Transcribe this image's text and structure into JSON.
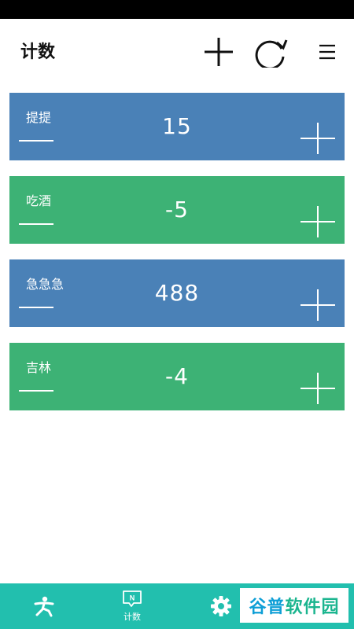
{
  "header": {
    "title": "计数",
    "add_icon": "plus-icon",
    "refresh_icon": "refresh-icon",
    "menu_icon": "menu-icon"
  },
  "colors": {
    "blue_card": "#4a81b7",
    "green_card": "#3db275",
    "nav_bg": "#22bfae"
  },
  "counters": [
    {
      "name": "提提",
      "value": "15",
      "color": "blue"
    },
    {
      "name": "吃酒",
      "value": "-5",
      "color": "green"
    },
    {
      "name": "急急急",
      "value": "488",
      "color": "blue"
    },
    {
      "name": "吉林",
      "value": "-4",
      "color": "green"
    }
  ],
  "bottom_nav": {
    "items": [
      {
        "icon": "person-icon",
        "label": ""
      },
      {
        "icon": "counter-icon",
        "label": "计数"
      },
      {
        "icon": "gear-icon",
        "label": ""
      }
    ]
  },
  "watermark": {
    "text_a": "谷普",
    "text_b": "软件园"
  }
}
